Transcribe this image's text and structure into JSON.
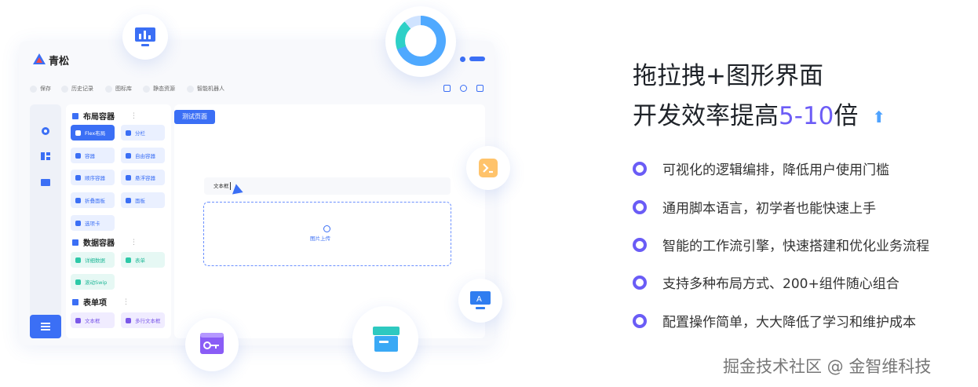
{
  "app": {
    "brand": "青松",
    "toolbar": [
      "保存",
      "历史记录",
      "图标库",
      "静态资源",
      "智能机器人"
    ],
    "sections": {
      "layout": {
        "title": "布局容器",
        "items": [
          "Flex布局",
          "分栏",
          "容器",
          "自由容器",
          "顺序容器",
          "悬浮容器",
          "折叠面板",
          "面板",
          "选项卡"
        ]
      },
      "data": {
        "title": "数据容器",
        "items": [
          "详细数据",
          "表单",
          "滚动Swip"
        ]
      },
      "form": {
        "title": "表单项",
        "items": [
          "文本框",
          "多行文本框"
        ]
      }
    },
    "canvas": {
      "tab_label": "测试页面",
      "text_field_label": "文本框",
      "upload_label": "图片上传"
    }
  },
  "headline": {
    "line1": "拖拉拽+图形界面",
    "line2_prefix": "开发效率提高",
    "line2_accent": "5-10",
    "line2_suffix": "倍"
  },
  "features": [
    "可视化的逻辑编排，降低用户使用门槛",
    "通用脚本语言，初学者也能快速上手",
    "智能的工作流引擎，快速搭建和优化业务流程",
    "支持多种布局方式、200+组件随心组合",
    "配置操作简单，大大降低了学习和维护成本"
  ],
  "watermark": "掘金技术社区 @ 金智维科技",
  "colors": {
    "primary": "#3b6ff5",
    "accent": "#6c5cf6",
    "teal": "#2cc9a7",
    "purple": "#7a57e8"
  },
  "icons": {
    "monitor": "monitor-chart-icon",
    "donut": "donut-chart-icon",
    "terminal": "terminal-icon",
    "display": "display-icon",
    "box": "box-icon",
    "key": "key-window-icon"
  }
}
